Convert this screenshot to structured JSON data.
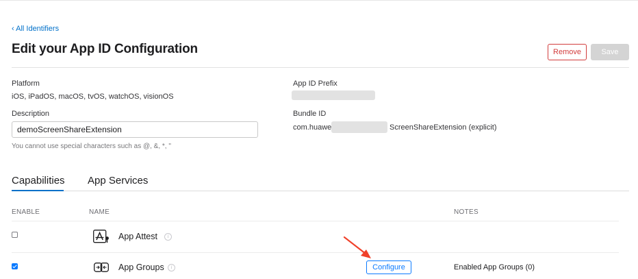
{
  "header": {
    "back_link": "‹ All Identifiers",
    "title": "Edit your App ID Configuration",
    "remove_label": "Remove",
    "save_label": "Save"
  },
  "platform": {
    "label": "Platform",
    "value": "iOS, iPadOS, macOS, tvOS, watchOS, visionOS"
  },
  "app_id_prefix": {
    "label": "App ID Prefix"
  },
  "description": {
    "label": "Description",
    "value": "demoScreenShareExtension",
    "hint": "You cannot use special characters such as @, &, *, \""
  },
  "bundle_id": {
    "label": "Bundle ID",
    "prefix": "com.huawei.",
    "suffix": "ScreenShareExtension (explicit)"
  },
  "tabs": [
    {
      "label": "Capabilities",
      "active": true
    },
    {
      "label": "App Services",
      "active": false
    }
  ],
  "table": {
    "columns": {
      "enable": "ENABLE",
      "name": "NAME",
      "notes": "NOTES"
    },
    "rows": [
      {
        "name": "App Attest",
        "enabled": false,
        "icon": "app-attest-icon",
        "notes": ""
      },
      {
        "name": "App Groups",
        "enabled": true,
        "icon": "app-groups-icon",
        "configure_label": "Configure",
        "notes": "Enabled App Groups (0)"
      }
    ]
  },
  "colors": {
    "accent": "#0070c9",
    "remove": "#d23c3c",
    "save_disabled": "#d4d4d4",
    "annotation_arrow": "#f0412a"
  }
}
